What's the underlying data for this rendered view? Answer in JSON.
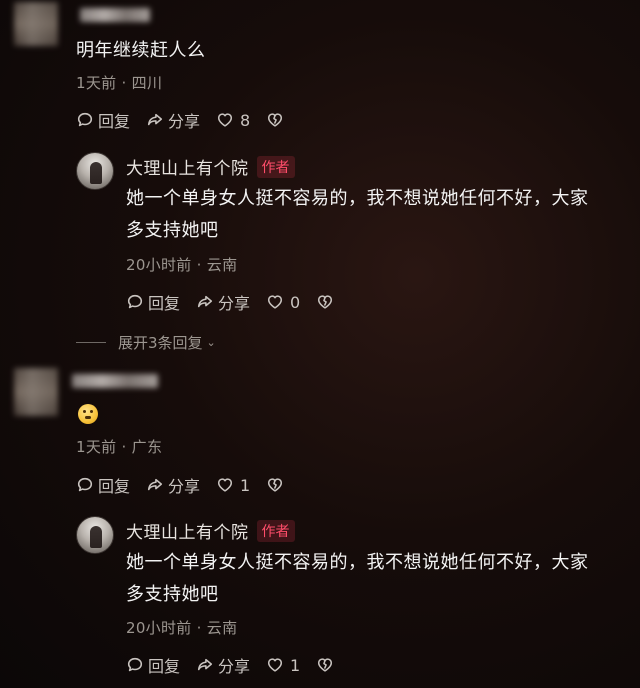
{
  "comments": [
    {
      "text": "明年继续赶人么",
      "meta": "1天前 · 四川",
      "reply_label": "回复",
      "share_label": "分享",
      "like_count": "8",
      "reply": {
        "author": "大理山上有个院",
        "badge": "作者",
        "text_line1": "她一个单身女人挺不容易的，我不想说她任何不好，大家",
        "text_line2": "多支持她吧",
        "meta": "20小时前 · 云南",
        "reply_label": "回复",
        "share_label": "分享",
        "like_count": "0"
      },
      "expand_label": "展开3条回复"
    },
    {
      "meta": "1天前 · 广东",
      "reply_label": "回复",
      "share_label": "分享",
      "like_count": "1",
      "reply": {
        "author": "大理山上有个院",
        "badge": "作者",
        "text_line1": "她一个单身女人挺不容易的，我不想说她任何不好，大家",
        "text_line2": "多支持她吧",
        "meta": "20小时前 · 云南",
        "reply_label": "回复",
        "share_label": "分享",
        "like_count": "1"
      }
    }
  ]
}
